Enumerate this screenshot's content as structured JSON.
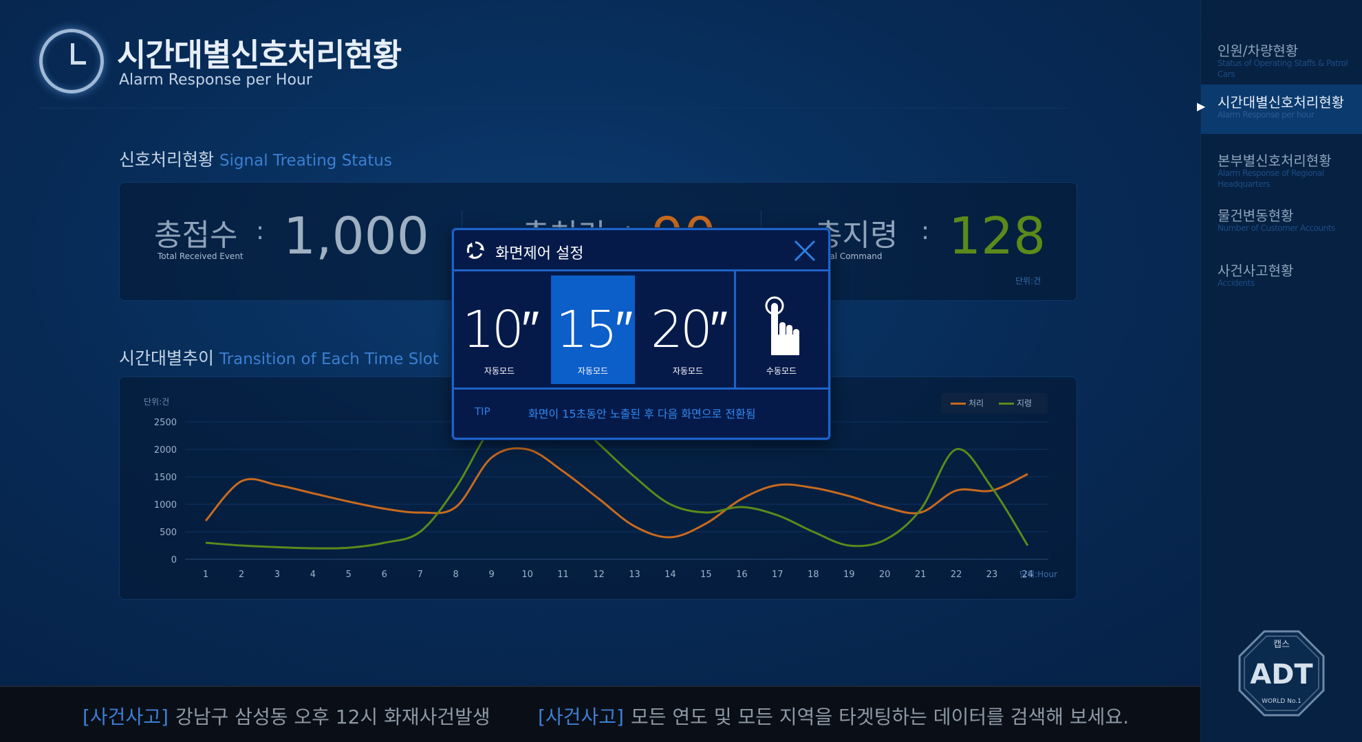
{
  "header": {
    "title": "시간대별신호처리현황",
    "subtitle": "Alarm Response per Hour"
  },
  "signal_section": {
    "title_ko": "신호처리현황",
    "title_en": "Signal Treating Status",
    "stats": [
      {
        "label_ko": "총접수",
        "label_en": "Total Received Event",
        "value": "1,000"
      },
      {
        "label_ko": "총처리",
        "label_en": "",
        "value": "90"
      },
      {
        "label_ko": "총지령",
        "label_en": "Total Command",
        "value": "128"
      }
    ],
    "unit": "단위:건"
  },
  "trend_section": {
    "title_ko": "시간대별추이",
    "title_en": "Transition of Each Time Slot"
  },
  "chart_data": {
    "type": "line",
    "y_unit_label": "단위:건",
    "x_unit_label": "단위:Hour",
    "x": [
      1,
      2,
      3,
      4,
      5,
      6,
      7,
      8,
      9,
      10,
      11,
      12,
      13,
      14,
      15,
      16,
      17,
      18,
      19,
      20,
      21,
      22,
      23,
      24
    ],
    "yticks": [
      0,
      500,
      1000,
      1500,
      2000,
      2500
    ],
    "ylim": [
      0,
      2500
    ],
    "grid": true,
    "legend_position": "top-right",
    "series": [
      {
        "name": "처리",
        "color": "#c86a1e",
        "values": [
          700,
          1420,
          1350,
          1200,
          1050,
          920,
          850,
          950,
          1850,
          2000,
          1600,
          1100,
          600,
          400,
          650,
          1100,
          1350,
          1300,
          1150,
          950,
          850,
          1250,
          1250,
          1550
        ]
      },
      {
        "name": "지령",
        "color": "#5c8a1a",
        "values": [
          300,
          250,
          220,
          200,
          210,
          300,
          500,
          1300,
          2400,
          2900,
          2700,
          2100,
          1500,
          1000,
          850,
          950,
          800,
          500,
          250,
          350,
          900,
          2000,
          1300,
          250
        ]
      }
    ]
  },
  "dialog": {
    "title": "화면제어 설정",
    "modes": [
      {
        "value": "10″",
        "caption": "자동모드"
      },
      {
        "value": "15″",
        "caption": "자동모드",
        "selected": true
      },
      {
        "value": "20″",
        "caption": "자동모드"
      },
      {
        "value": "",
        "caption": "수동모드",
        "icon": "hand-pointer-icon"
      }
    ],
    "tip_label": "TIP",
    "tip_message": "화면이 15초동안 노출된 후 다음 화면으로 전환됨"
  },
  "ticker": [
    {
      "tag": "[사건사고]",
      "message": "강남구 삼성동 오후 12시 화재사건발생"
    },
    {
      "tag": "[사건사고]",
      "message": "모든 연도 및 모든 지역을 타겟팅하는 데이터를 검색해 보세요."
    }
  ],
  "sidebar": {
    "items": [
      {
        "ko": "인원/차량현황",
        "en": "Status of Operating Staffs & Patrol Cars"
      },
      {
        "ko": "시간대별신호처리현황",
        "en": "Alarm Response per hour",
        "active": true
      },
      {
        "ko": "본부별신호처리현황",
        "en": "Alarm Response of Regional Headquarters"
      },
      {
        "ko": "물건변동현황",
        "en": "Number of Customer Accounts"
      },
      {
        "ko": "사건사고현황",
        "en": "Accidents"
      }
    ],
    "logo": {
      "top_text": "캡스",
      "main_text": "ADT",
      "bottom_text": "WORLD No.1"
    }
  },
  "colors": {
    "background": "#072a55",
    "accent_blue": "#1e63c7",
    "processed": "#c86a1e",
    "command": "#5c8a1a"
  }
}
